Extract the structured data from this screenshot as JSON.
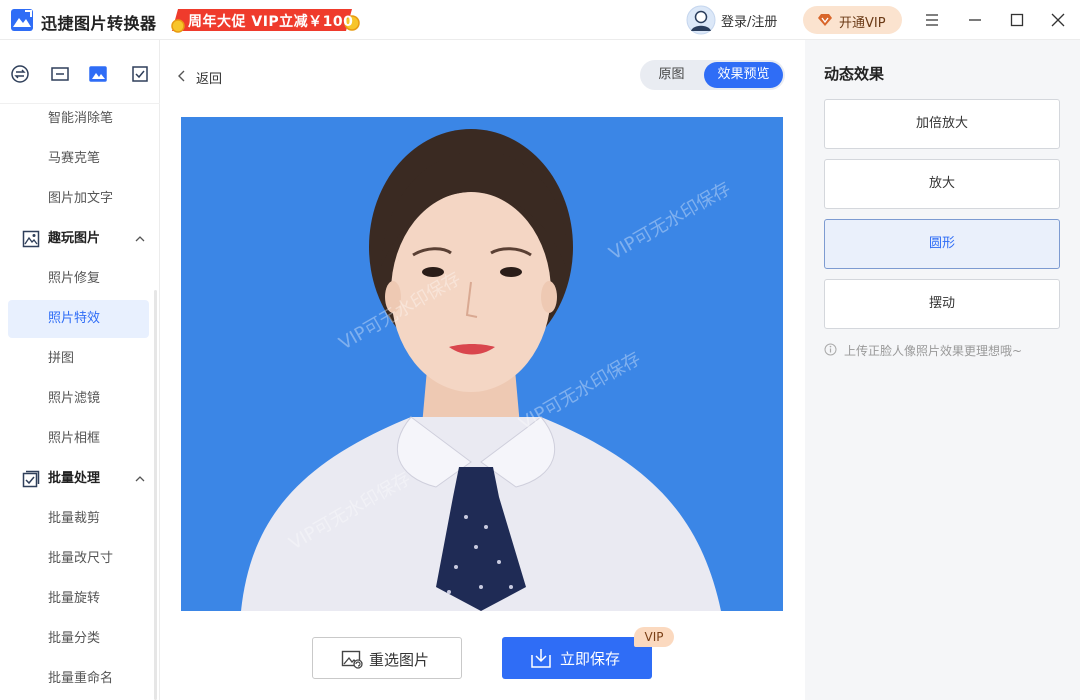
{
  "app": {
    "title": "迅捷图片转换器",
    "promo": "周年大促 VIP立减￥100",
    "login": "登录/注册",
    "vip_button": "开通VIP"
  },
  "colors": {
    "accent": "#2f6df6",
    "photo_background": "#3b86e6",
    "promo_red": "#ef3b2c",
    "vip_gold": "#fbe3cf"
  },
  "sidebar": {
    "top_icons": [
      "convert-icon",
      "image-edit-icon",
      "picture-icon",
      "batch-check-icon"
    ],
    "items_before": [
      {
        "label": "智能消除笔"
      },
      {
        "label": "马赛克笔"
      },
      {
        "label": "图片加文字"
      }
    ],
    "group_fun": {
      "label": "趣玩图片",
      "icon": "fun-picture-icon"
    },
    "fun_items": [
      {
        "label": "照片修复"
      },
      {
        "label": "照片特效",
        "active": true
      },
      {
        "label": "拼图"
      },
      {
        "label": "照片滤镜"
      },
      {
        "label": "照片相框"
      }
    ],
    "group_batch": {
      "label": "批量处理",
      "icon": "batch-icon"
    },
    "batch_items": [
      {
        "label": "批量裁剪"
      },
      {
        "label": "批量改尺寸"
      },
      {
        "label": "批量旋转"
      },
      {
        "label": "批量分类"
      },
      {
        "label": "批量重命名"
      }
    ]
  },
  "center": {
    "back": "返回",
    "toggle_original": "原图",
    "toggle_preview": "效果预览",
    "watermark": "VIP可无水印保存",
    "reselect": "重选图片",
    "save": "立即保存",
    "vip_tag": "VIP"
  },
  "right_panel": {
    "title": "动态效果",
    "effects": [
      {
        "label": "加倍放大"
      },
      {
        "label": "放大"
      },
      {
        "label": "圆形",
        "selected": true
      },
      {
        "label": "摆动"
      }
    ],
    "hint": "上传正脸人像照片效果更理想哦~"
  }
}
